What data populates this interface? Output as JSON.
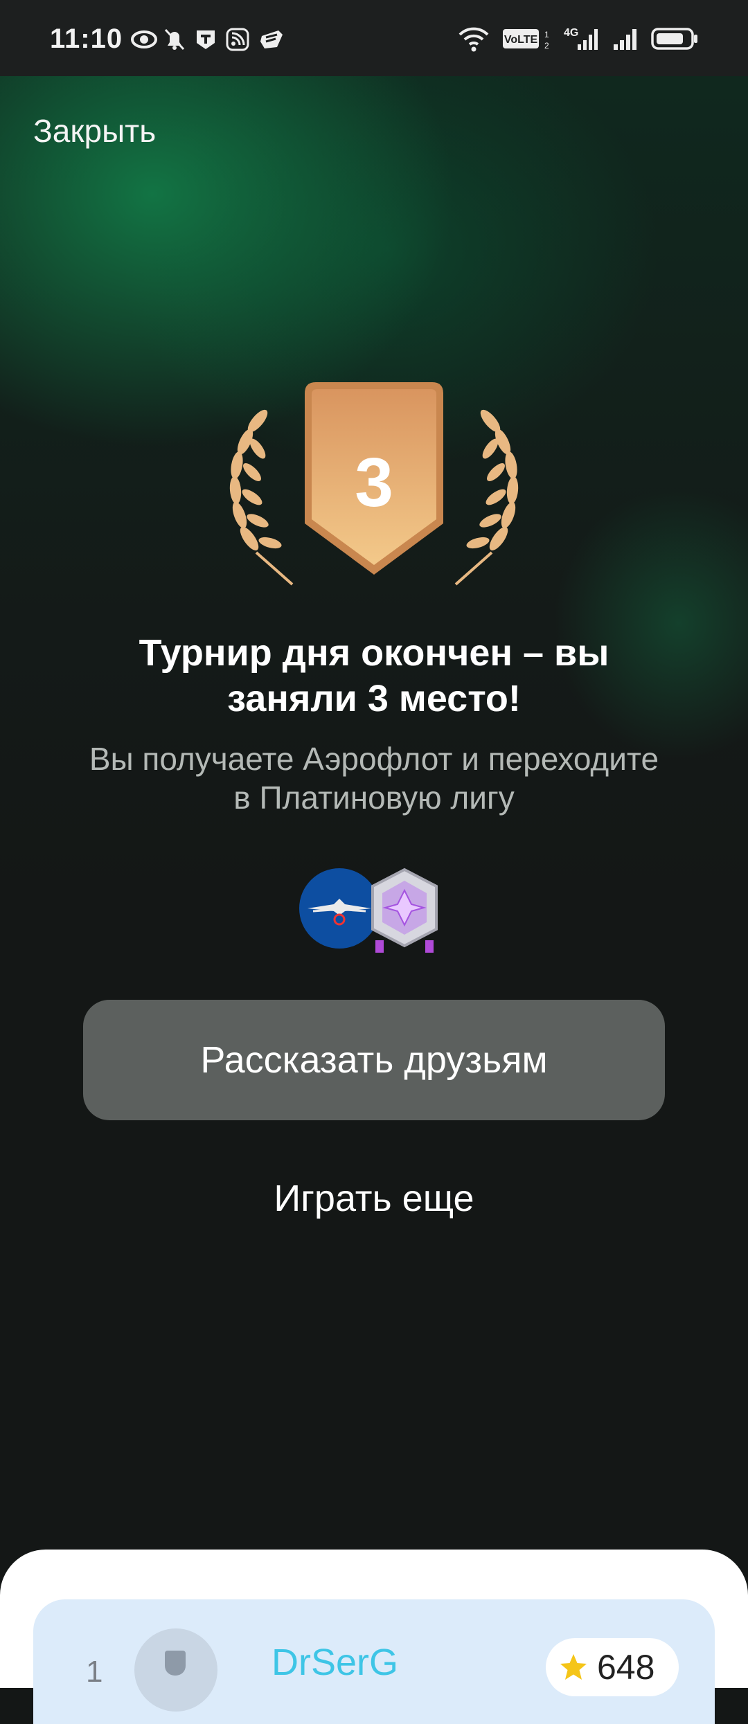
{
  "status_bar": {
    "time": "11:10",
    "left_icons": [
      "eye-icon",
      "muted-bell-icon",
      "t-app-icon",
      "rss-icon",
      "cloud-app-icon"
    ],
    "right_icons": [
      "wifi-icon",
      "volte-icon",
      "4g-signal-icon",
      "signal-icon",
      "battery-icon"
    ],
    "volte": "VoLTE",
    "net": "4G"
  },
  "header": {
    "close_label": "Закрыть"
  },
  "result": {
    "place": "3",
    "headline": "Турнир дня окончен – вы заняли 3 место!",
    "subline": "Вы получаете Аэрофлот и переходите в Платиновую лигу",
    "reward_icons": [
      "aeroflot-logo-icon",
      "platinum-league-icon"
    ]
  },
  "actions": {
    "share_label": "Рассказать друзьям",
    "play_again_label": "Играть еще"
  },
  "leaderboard": {
    "rows": [
      {
        "rank": "1",
        "name": "DrSerG",
        "score": "648"
      }
    ]
  },
  "colors": {
    "accent_green": "#127846",
    "badge_bronze": "#e3a56e",
    "button_gray": "#5c605e",
    "username_blue": "#3ec5e6"
  }
}
